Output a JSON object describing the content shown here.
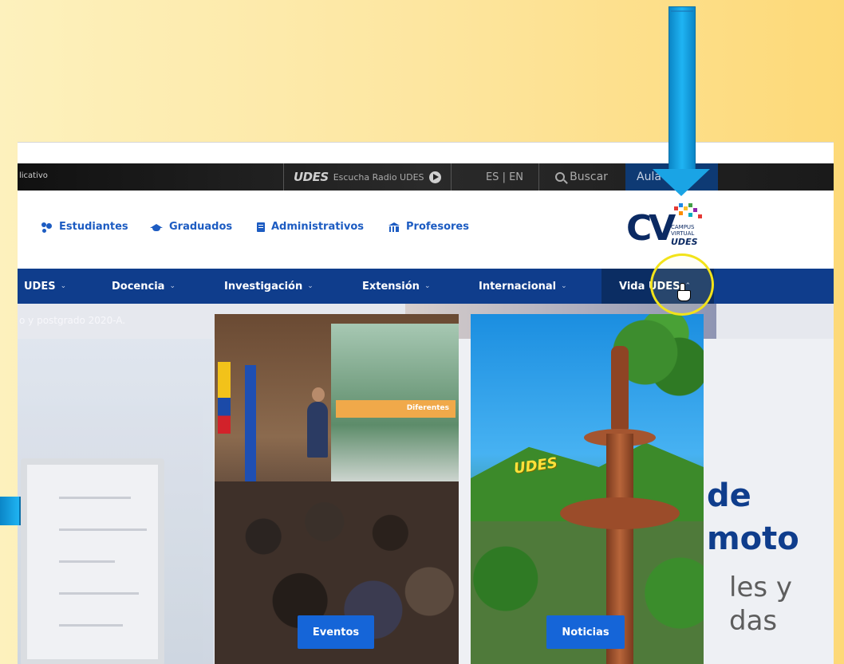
{
  "topbar": {
    "left_text": "licativo",
    "radio_logo": "UDES",
    "radio_text": "Escucha Radio UDES",
    "lang": "ES | EN",
    "search": "Buscar",
    "aula": "Aula"
  },
  "userbar": {
    "items": [
      {
        "label": "Estudiantes",
        "icon": "users-icon"
      },
      {
        "label": "Graduados",
        "icon": "graduation-cap-icon"
      },
      {
        "label": "Administrativos",
        "icon": "document-icon"
      },
      {
        "label": "Profesores",
        "icon": "institution-icon"
      }
    ],
    "logo": {
      "letters": "CV",
      "line1": "CAMPUS",
      "line2": "VIRTUAL",
      "brand": "UDES"
    }
  },
  "nav": {
    "items": [
      {
        "label": "UDES"
      },
      {
        "label": "Docencia"
      },
      {
        "label": "Investigación"
      },
      {
        "label": "Extensión"
      },
      {
        "label": "Internacional"
      },
      {
        "label": "Vida UDES"
      }
    ]
  },
  "ticker": {
    "text": "o y postgrado 2020-A."
  },
  "cards": [
    {
      "button": "Eventos",
      "screen_banner": "Diferentes"
    },
    {
      "button": "Noticias",
      "sign": "UDES"
    }
  ],
  "hero_text": {
    "line1": "de",
    "line2": "moto",
    "line3": "les y",
    "line4": "das"
  },
  "colors": {
    "nav_bg": "#0f3d8c",
    "accent_blue": "#1d5cc2",
    "button_blue": "#1565d8",
    "arrow_blue": "#1aa4e5",
    "highlight_yellow": "#f2e31a"
  }
}
